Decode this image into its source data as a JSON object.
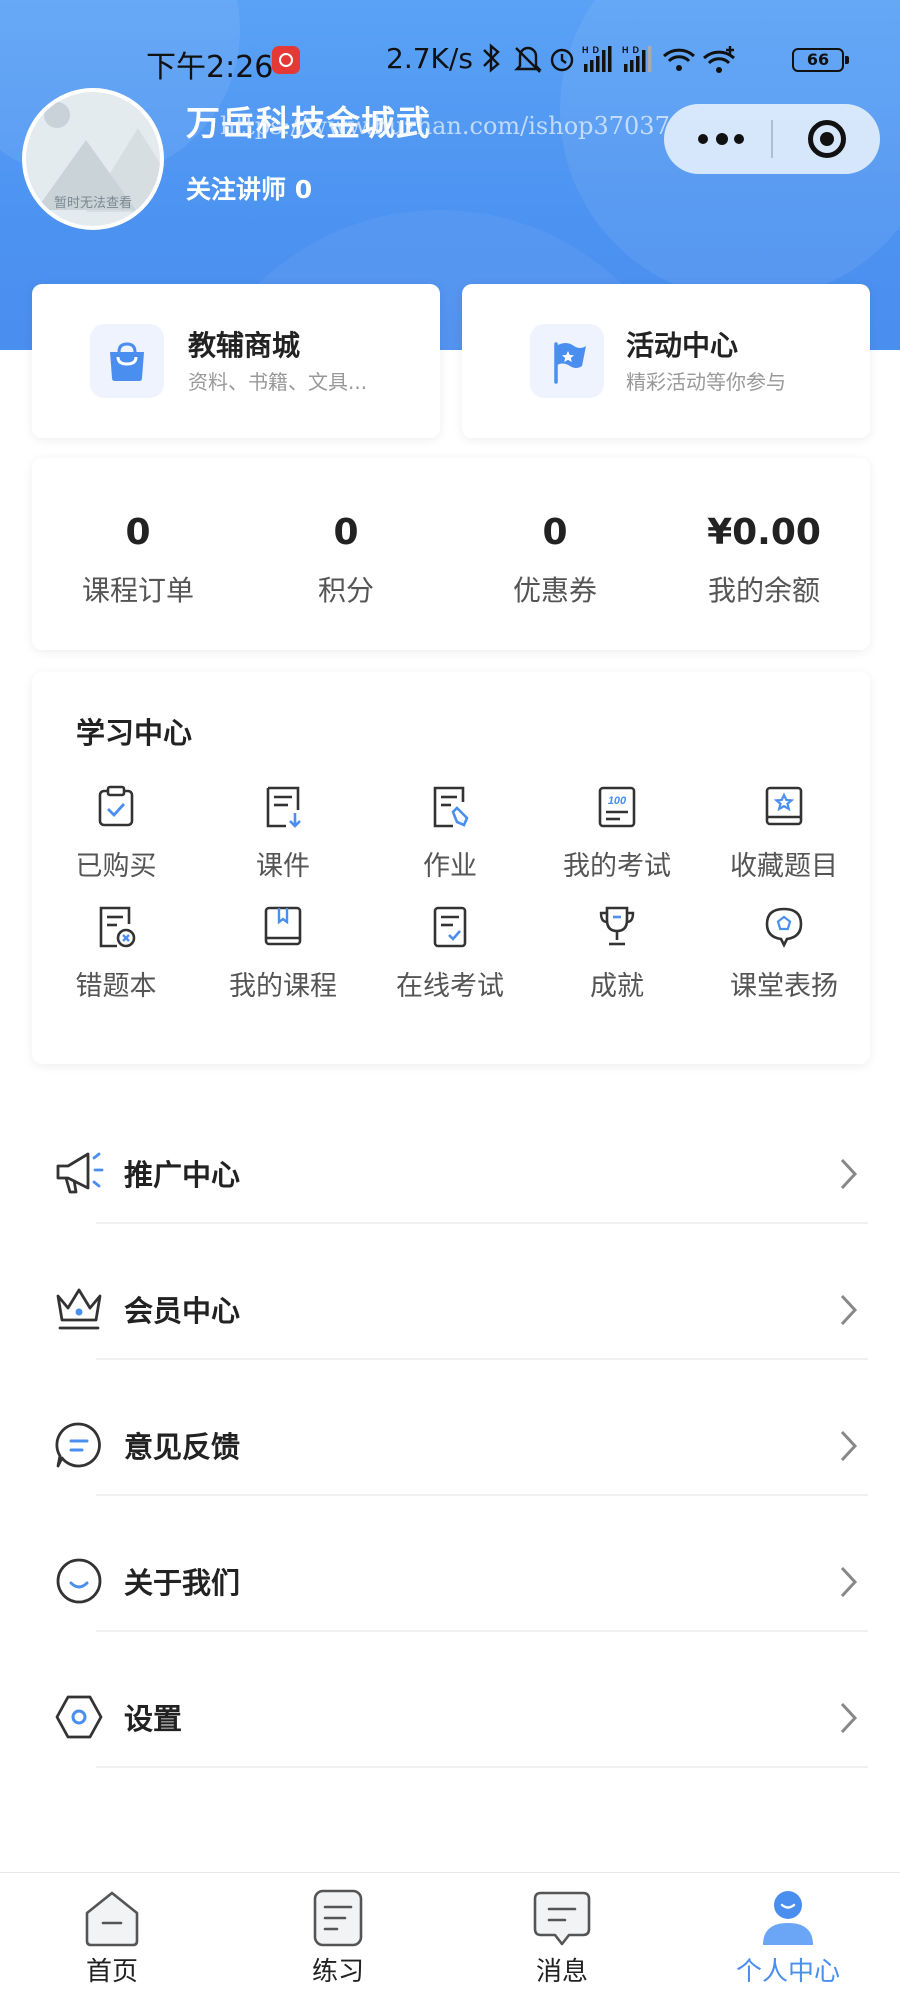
{
  "status_bar": {
    "time": "下午2:26",
    "net_speed": "2.7K/s",
    "battery": "66",
    "icons": [
      "netease-music-icon",
      "bluetooth-icon",
      "mute-icon",
      "alarm-icon",
      "signal-hd-icon",
      "signal-hd-icon",
      "wifi-icon",
      "wifi-plus-icon",
      "battery-icon"
    ]
  },
  "profile": {
    "avatar_text": "暂时无法查看",
    "name": "万岳科技金城武",
    "watermark": "https://www.huzhan.com/ishop37037",
    "follow_label": "关注讲师",
    "follow_count": "0"
  },
  "cards": {
    "shop": {
      "title": "教辅商城",
      "subtitle": "资料、书籍、文具...",
      "icon": "shopping-bag-icon"
    },
    "activity": {
      "title": "活动中心",
      "subtitle": "精彩活动等你参与",
      "icon": "flag-icon"
    }
  },
  "stats": [
    {
      "value": "0",
      "label": "课程订单"
    },
    {
      "value": "0",
      "label": "积分"
    },
    {
      "value": "0",
      "label": "优惠券"
    },
    {
      "value": "¥0.00",
      "label": "我的余额"
    }
  ],
  "study_center": {
    "title": "学习中心",
    "items": [
      {
        "label": "已购买",
        "icon": "clipboard-check-icon"
      },
      {
        "label": "课件",
        "icon": "doc-download-icon"
      },
      {
        "label": "作业",
        "icon": "doc-pen-icon"
      },
      {
        "label": "我的考试",
        "icon": "score-100-icon"
      },
      {
        "label": "收藏题目",
        "icon": "star-book-icon"
      },
      {
        "label": "错题本",
        "icon": "doc-error-icon"
      },
      {
        "label": "我的课程",
        "icon": "book-icon"
      },
      {
        "label": "在线考试",
        "icon": "doc-check-icon"
      },
      {
        "label": "成就",
        "icon": "trophy-icon"
      },
      {
        "label": "课堂表扬",
        "icon": "praise-bubble-icon"
      }
    ]
  },
  "menu": [
    {
      "label": "推广中心",
      "icon": "megaphone-icon"
    },
    {
      "label": "会员中心",
      "icon": "crown-icon"
    },
    {
      "label": "意见反馈",
      "icon": "feedback-bubble-icon"
    },
    {
      "label": "关于我们",
      "icon": "smile-circle-icon"
    },
    {
      "label": "设置",
      "icon": "settings-hex-icon"
    }
  ],
  "tabbar": [
    {
      "label": "首页",
      "icon": "home-icon",
      "active": false
    },
    {
      "label": "练习",
      "icon": "practice-icon",
      "active": false
    },
    {
      "label": "消息",
      "icon": "message-icon",
      "active": false
    },
    {
      "label": "个人中心",
      "icon": "profile-icon",
      "active": true
    }
  ],
  "colors": {
    "header_blue": "#4d93f1",
    "accent_blue": "#4a8ef0",
    "icon_dark": "#333333",
    "text_muted": "#999999"
  }
}
